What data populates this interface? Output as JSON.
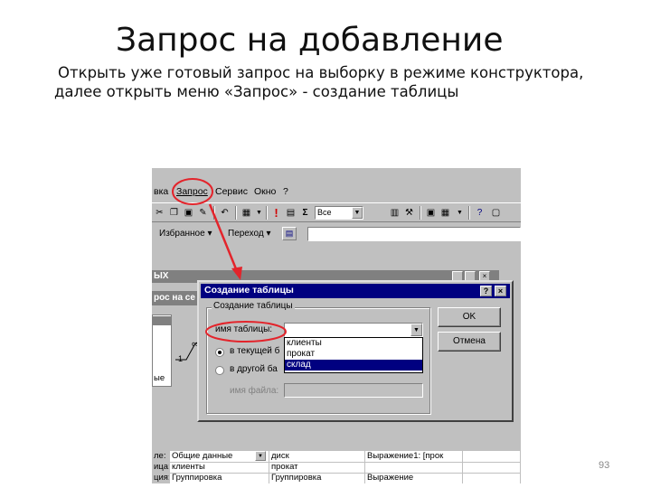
{
  "slide": {
    "title": "Запрос на добавление",
    "line1": "Открыть уже готовый запрос на выборку в режиме конструктора,",
    "line2": "далее открыть меню «Запрос» - создание таблицы",
    "page_number": "93"
  },
  "menu": {
    "items": [
      "вка",
      "Запрос",
      "Сервис",
      "Окно",
      "?"
    ]
  },
  "toolbar": {
    "combo_value": "Все"
  },
  "toolbar2": {
    "favorites": "Избранное ▾",
    "goto": "Переход ▾"
  },
  "mdi_window": {
    "header_text": "ЫХ",
    "title_fragment": "рос на се"
  },
  "background_fragments": {
    "join_one": "1",
    "join_many": "∞",
    "field_fragment": "ые"
  },
  "dialog": {
    "title": "Создание таблицы",
    "help_button": "?",
    "close_button": "×",
    "group_label": "Создание таблицы",
    "table_name_label": "имя таблицы:",
    "table_name_value": "",
    "options": [
      {
        "label": "клиенты",
        "selected": false
      },
      {
        "label": "прокат",
        "selected": false
      },
      {
        "label": "склад",
        "selected": true
      }
    ],
    "radio_current_db": "в текущей б",
    "radio_other_db": "в другой ба",
    "file_name_label": "имя файла:",
    "file_name_value": "",
    "ok_button": "OK",
    "cancel_button": "Отмена"
  },
  "grid": {
    "rows": [
      {
        "head": "ле:",
        "c1": "Общие данные",
        "c2": "диск",
        "c3": "Выражение1: [прок"
      },
      {
        "head": "ица:",
        "c1": "клиенты",
        "c2": "прокат",
        "c3": ""
      },
      {
        "head": "ция:",
        "c1": "Группировка",
        "c2": "Группировка",
        "c3": "Выражение"
      }
    ]
  },
  "colors": {
    "dialog_title": "#000080",
    "annotation": "#e3242b",
    "selection": "#000080"
  }
}
